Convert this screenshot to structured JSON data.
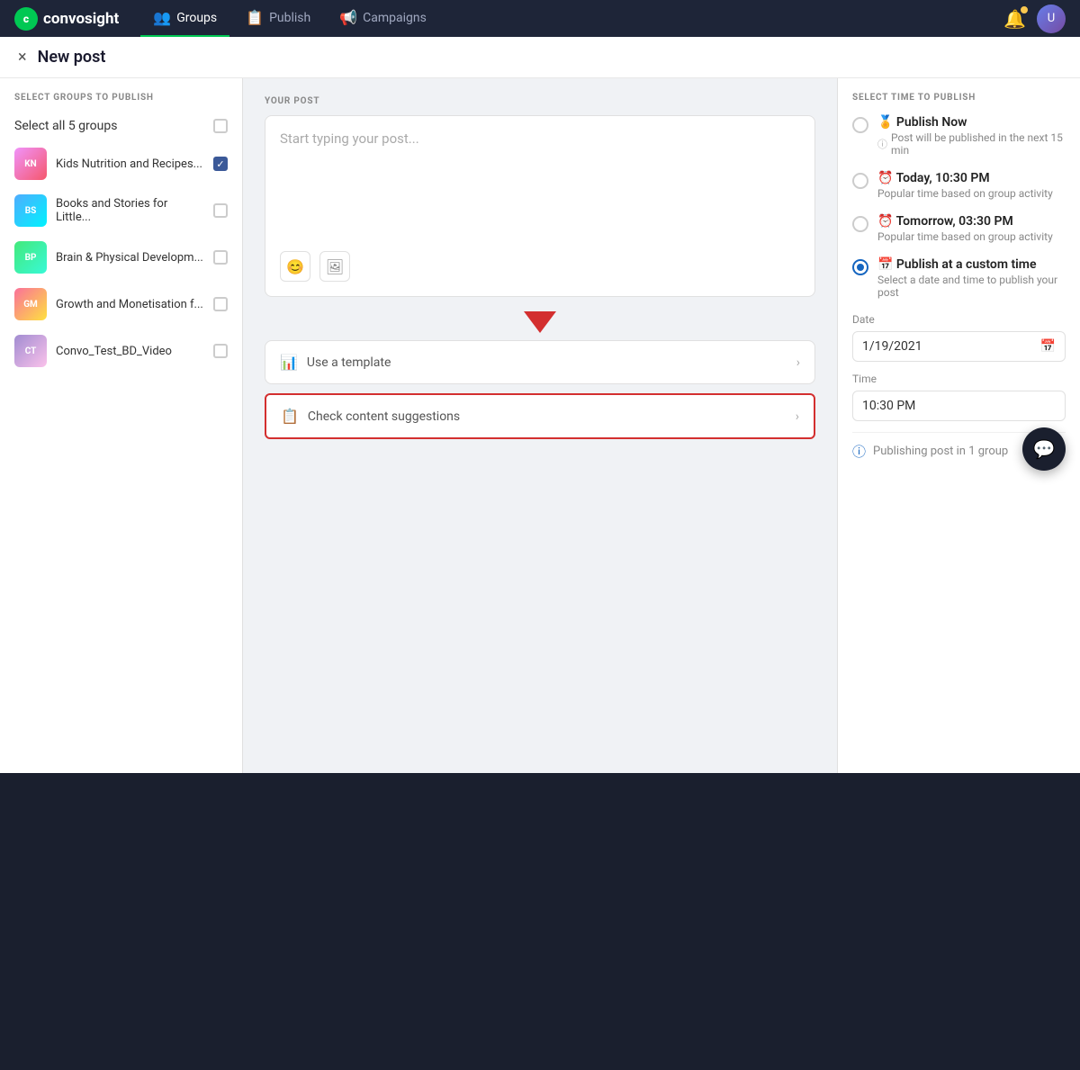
{
  "navbar": {
    "brand": "convosight",
    "nav_items": [
      {
        "label": "Groups",
        "icon": "👥",
        "active": true
      },
      {
        "label": "Publish",
        "icon": "📋",
        "active": false
      },
      {
        "label": "Campaigns",
        "icon": "📢",
        "active": false
      }
    ]
  },
  "page": {
    "title": "New post",
    "close_icon": "×"
  },
  "left_panel": {
    "section_label": "SELECT GROUPS TO PUBLISH",
    "select_all_label": "Select all 5 groups",
    "groups": [
      {
        "name": "Kids Nutrition and Recipes...",
        "checked": true,
        "color": "g1"
      },
      {
        "name": "Books and Stories for Little...",
        "checked": false,
        "color": "g2"
      },
      {
        "name": "Brain & Physical Developm...",
        "checked": false,
        "color": "g3"
      },
      {
        "name": "Growth and Monetisation f...",
        "checked": false,
        "color": "g4"
      },
      {
        "name": "Convo_Test_BD_Video",
        "checked": false,
        "color": "g5"
      }
    ]
  },
  "center_panel": {
    "section_label": "YOUR POST",
    "placeholder": "Start typing your post...",
    "use_template_label": "Use a template",
    "check_suggestions_label": "Check content suggestions"
  },
  "right_panel": {
    "section_label": "SELECT TIME TO PUBLISH",
    "options": [
      {
        "title": "🏅 Publish Now",
        "subtitle": "Post will be published in the next 15 min",
        "has_info": true,
        "selected": false
      },
      {
        "title": "⏰ Today, 10:30 PM",
        "subtitle": "Popular time based on group activity",
        "has_info": false,
        "selected": false
      },
      {
        "title": "⏰ Tomorrow, 03:30 PM",
        "subtitle": "Popular time based on group activity",
        "has_info": false,
        "selected": false
      },
      {
        "title": "📅 Publish at a custom time",
        "subtitle": "Select a date and time to publish your post",
        "has_info": false,
        "selected": true
      }
    ],
    "date_label": "Date",
    "date_value": "1/19/2021",
    "time_label": "Time",
    "time_value": "10:30 PM",
    "publishing_info": "Publishing post in 1 group"
  },
  "chat_bubble_icon": "💬"
}
